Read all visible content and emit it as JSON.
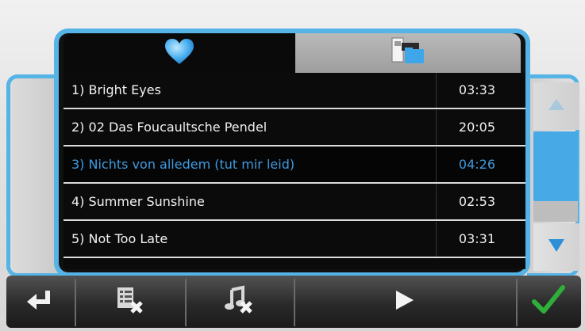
{
  "tabs": [
    {
      "icon": "heart-icon",
      "active": true
    },
    {
      "icon": "browse-folder-icon",
      "active": false
    }
  ],
  "tracks": [
    {
      "title": "1) Bright Eyes",
      "duration": "03:33",
      "selected": false
    },
    {
      "title": "2) 02 Das Foucaultsche Pendel",
      "duration": "20:05",
      "selected": false
    },
    {
      "title": "3) Nichts von alledem (tut mir leid)",
      "duration": "04:26",
      "selected": true
    },
    {
      "title": "4) Summer Sunshine",
      "duration": "02:53",
      "selected": false
    },
    {
      "title": "5) Not Too Late",
      "duration": "03:31",
      "selected": false
    }
  ],
  "toolbar": {
    "buttons": [
      "back-icon",
      "delete-list-icon",
      "delete-song-icon",
      "play-icon",
      "confirm-check-icon"
    ]
  },
  "colors": {
    "accent": "#56b3e6",
    "selected_text": "#3f9be0",
    "check": "#2fae3a"
  }
}
